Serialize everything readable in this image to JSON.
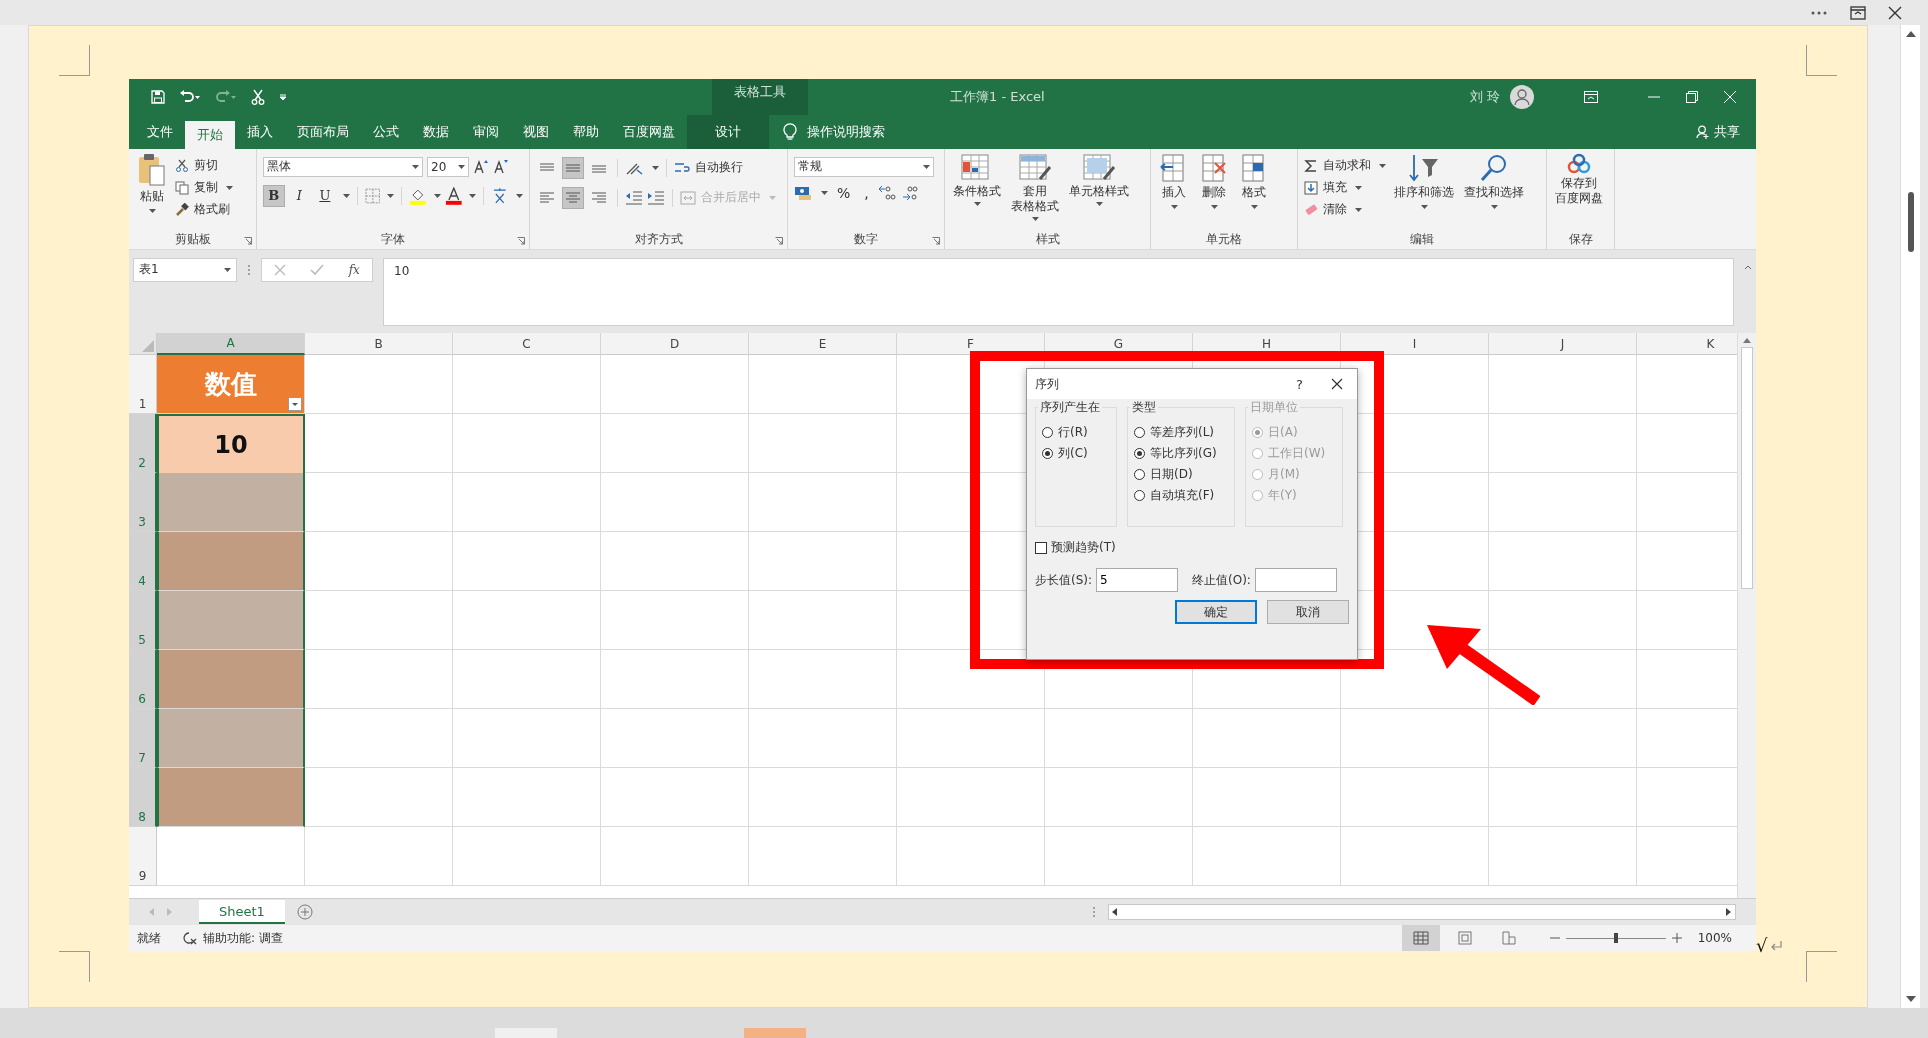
{
  "excel": {
    "contextual_title": "表格工具",
    "title": "工作簿1  -  Excel",
    "user": "刘 玲",
    "tabs": [
      {
        "label": "文件",
        "selected": false,
        "kind": "normal"
      },
      {
        "label": "开始",
        "selected": true,
        "kind": "normal"
      },
      {
        "label": "插入",
        "selected": false,
        "kind": "normal"
      },
      {
        "label": "页面布局",
        "selected": false,
        "kind": "normal"
      },
      {
        "label": "公式",
        "selected": false,
        "kind": "normal"
      },
      {
        "label": "数据",
        "selected": false,
        "kind": "normal"
      },
      {
        "label": "审阅",
        "selected": false,
        "kind": "normal"
      },
      {
        "label": "视图",
        "selected": false,
        "kind": "normal"
      },
      {
        "label": "帮助",
        "selected": false,
        "kind": "normal"
      },
      {
        "label": "百度网盘",
        "selected": false,
        "kind": "normal"
      },
      {
        "label": "设计",
        "selected": false,
        "kind": "contextual"
      }
    ],
    "search": "操作说明搜索",
    "share": "共享",
    "ribbon": {
      "clipboard": {
        "paste": "粘贴",
        "cut": "剪切",
        "copy": "复制",
        "format_painter": "格式刷",
        "label": "剪贴板"
      },
      "font": {
        "name": "黑体",
        "size": "20",
        "styles": [
          {
            "label": "B",
            "kind": "bold",
            "pressed": true
          },
          {
            "label": "I",
            "kind": "italic",
            "pressed": false
          },
          {
            "label": "U",
            "kind": "underline",
            "pressed": false
          }
        ],
        "label": "字体"
      },
      "alignment": {
        "valign": [
          {
            "selected": false
          },
          {
            "selected": true
          },
          {
            "selected": false
          }
        ],
        "halign": [
          {
            "selected": false
          },
          {
            "selected": true
          },
          {
            "selected": false
          }
        ],
        "wrap": "自动换行",
        "merge": "合并后居中",
        "merge_disabled": true,
        "label": "对齐方式"
      },
      "number": {
        "format": "常规",
        "percent": "%",
        "comma": ",",
        "label": "数字"
      },
      "styles": {
        "items": [
          [
            "条件格式"
          ],
          [
            "套用",
            "表格格式"
          ],
          [
            "单元格样式"
          ]
        ],
        "label": "样式"
      },
      "cells": {
        "items": [
          "插入",
          "删除",
          "格式"
        ],
        "label": "单元格"
      },
      "editing": {
        "autosum": "自动求和",
        "fill": "填充",
        "clear": "清除",
        "sort": "排序和筛选",
        "find": "查找和选择",
        "label": "编辑"
      },
      "save": {
        "item": [
          "保存到",
          "百度网盘"
        ],
        "label": "保存"
      }
    },
    "formula_bar": {
      "name_box": "表1",
      "function_label": "fx",
      "content": "10"
    },
    "columns": [
      {
        "label": "A",
        "selected": true
      },
      {
        "label": "B",
        "selected": false
      },
      {
        "label": "C",
        "selected": false
      },
      {
        "label": "D",
        "selected": false
      },
      {
        "label": "E",
        "selected": false
      },
      {
        "label": "F",
        "selected": false
      },
      {
        "label": "G",
        "selected": false
      },
      {
        "label": "H",
        "selected": false
      },
      {
        "label": "I",
        "selected": false
      },
      {
        "label": "J",
        "selected": false
      },
      {
        "label": "K",
        "selected": false
      }
    ],
    "rows": [
      {
        "number": "1",
        "kind": "header",
        "value": "数值"
      },
      {
        "number": "2",
        "kind": "active",
        "value": "10"
      },
      {
        "number": "3",
        "kind": "selected"
      },
      {
        "number": "4",
        "kind": "selected"
      },
      {
        "number": "5",
        "kind": "selected"
      },
      {
        "number": "6",
        "kind": "selected"
      },
      {
        "number": "7",
        "kind": "selected"
      },
      {
        "number": "8",
        "kind": "selected"
      },
      {
        "number": "9",
        "kind": "plain"
      }
    ],
    "sheets": [
      {
        "name": "Sheet1",
        "selected": true
      }
    ],
    "status": {
      "ready": "就绪",
      "accessibility": "辅助功能: 调查",
      "zoom_slider": {
        "level": 0.5
      },
      "zoom": "100%"
    },
    "dialog": {
      "title": "序列",
      "help": "?",
      "groups": [
        {
          "title": "序列产生在",
          "disabled": false,
          "options": [
            {
              "label": "行(R)",
              "selected": false
            },
            {
              "label": "列(C)",
              "selected": true
            }
          ]
        },
        {
          "title": "类型",
          "disabled": false,
          "options": [
            {
              "label": "等差序列(L)",
              "selected": false
            },
            {
              "label": "等比序列(G)",
              "selected": true
            },
            {
              "label": "日期(D)",
              "selected": false
            },
            {
              "label": "自动填充(F)",
              "selected": false
            }
          ]
        },
        {
          "title": "日期单位",
          "disabled": true,
          "options": [
            {
              "label": "日(A)",
              "selected": true
            },
            {
              "label": "工作日(W)",
              "selected": false
            },
            {
              "label": "月(M)",
              "selected": false
            },
            {
              "label": "年(Y)",
              "selected": false
            }
          ]
        }
      ],
      "trend": {
        "label": "预测趋势(T)",
        "checked": false
      },
      "step": {
        "label": "步长值(S):",
        "value": "5"
      },
      "stop": {
        "label": "终止值(O):"
      },
      "buttons": [
        {
          "label": "确定",
          "default": true
        },
        {
          "label": "取消",
          "default": false
        }
      ]
    }
  },
  "document": {
    "mark": "√"
  }
}
